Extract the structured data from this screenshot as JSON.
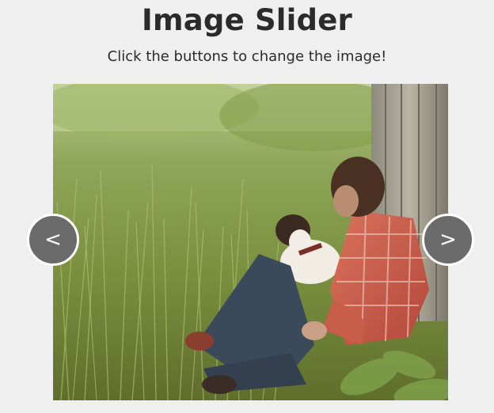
{
  "header": {
    "title": "Image Slider",
    "subtitle": "Click the buttons to change the image!"
  },
  "slider": {
    "image": "photo-man-with-dog-in-grass",
    "prev_label": "<",
    "next_label": ">"
  },
  "colors": {
    "background": "#efefef",
    "text": "#2b2b2b",
    "button_fill": "#6b6b6b",
    "button_border": "#ffffff"
  }
}
